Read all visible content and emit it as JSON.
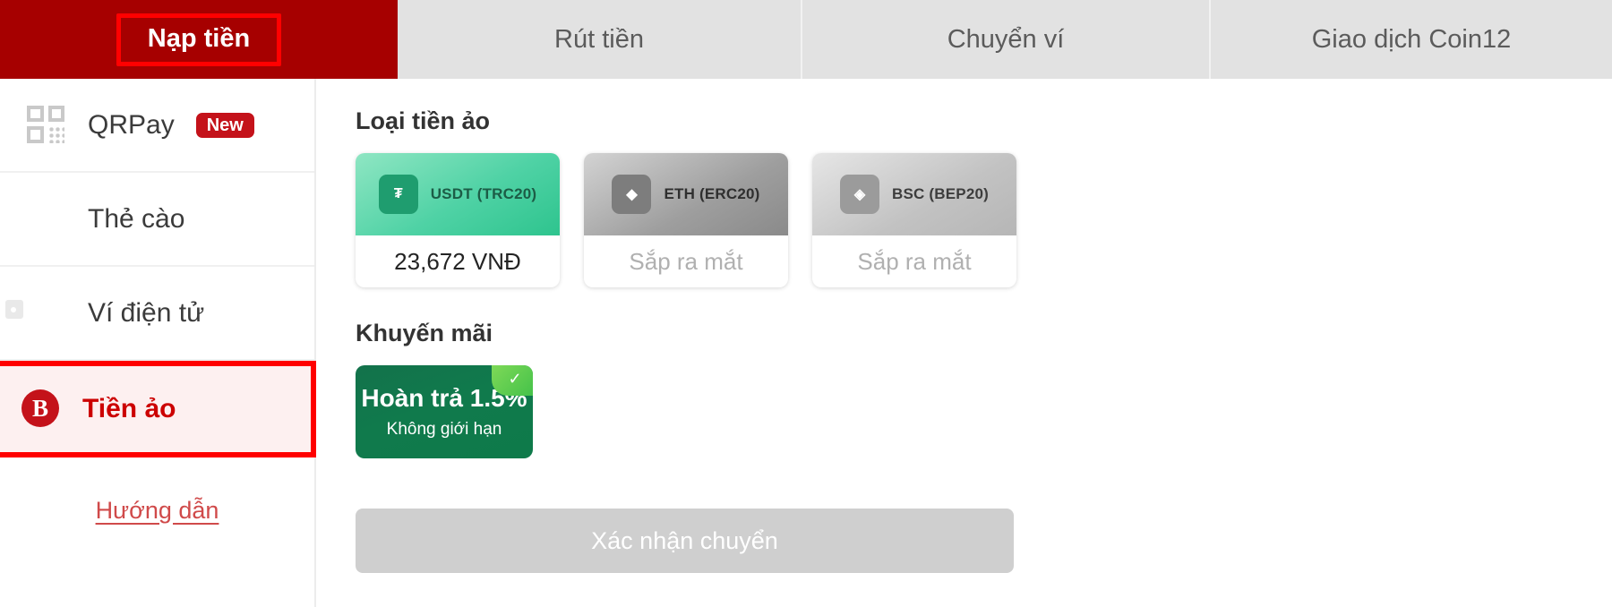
{
  "tabs": [
    {
      "label": "Nạp tiền",
      "active": true
    },
    {
      "label": "Rút tiền",
      "active": false
    },
    {
      "label": "Chuyển ví",
      "active": false
    },
    {
      "label": "Giao dịch Coin12",
      "active": false
    }
  ],
  "sidebar": {
    "items": [
      {
        "label": "QRPay",
        "icon": "qr-code-icon",
        "badge": "New",
        "selected": false
      },
      {
        "label": "Thẻ cào",
        "icon": "card-icon",
        "badge": "",
        "selected": false
      },
      {
        "label": "Ví điện tử",
        "icon": "wallet-icon",
        "badge": "",
        "selected": false
      },
      {
        "label": "Tiền ảo",
        "icon": "bitcoin-icon",
        "badge": "",
        "selected": true
      }
    ],
    "guide_link": "Hướng dẫn"
  },
  "main": {
    "coin_section_title": "Loại tiền ảo",
    "coins": [
      {
        "name": "USDT (TRC20)",
        "icon": "tether-icon",
        "glyph": "₮",
        "value": "23,672 VNĐ",
        "enabled": true
      },
      {
        "name": "ETH (ERC20)",
        "icon": "ethereum-icon",
        "glyph": "◆",
        "value": "Sắp ra mắt",
        "enabled": false
      },
      {
        "name": "BSC (BEP20)",
        "icon": "binance-icon",
        "glyph": "◈",
        "value": "Sắp ra mắt",
        "enabled": false
      }
    ],
    "promo_section_title": "Khuyến mãi",
    "promo": {
      "title": "Hoàn trả 1.5%",
      "subtitle": "Không giới hạn",
      "check_glyph": "✓"
    },
    "confirm_label": "Xác nhận chuyển"
  },
  "colors": {
    "active_tab_bg": "#a60000",
    "highlight_border": "#ff0000",
    "brand_red": "#cc0000",
    "usdt_green": "#2ec48e",
    "promo_green": "#0e7a4a",
    "disabled_grey": "#cfcfcf"
  }
}
